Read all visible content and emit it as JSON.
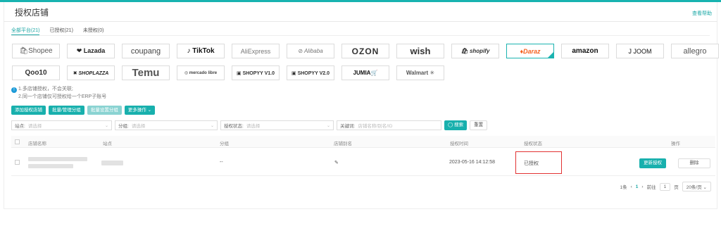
{
  "header": {
    "title": "授权店铺",
    "help": "查看帮助"
  },
  "tabs": [
    {
      "label": "全部平台(21)",
      "active": true
    },
    {
      "label": "已授权(21)",
      "active": false
    },
    {
      "label": "未授权(0)",
      "active": false
    }
  ],
  "platforms_row1": [
    {
      "label": "🛍Shopee",
      "name": "shopee"
    },
    {
      "label": "❤ Lazada",
      "name": "lazada"
    },
    {
      "label": "coupang",
      "name": "coupang"
    },
    {
      "label": "♪ TikTok",
      "name": "tiktok"
    },
    {
      "label": "AliExpress",
      "name": "aliexpress"
    },
    {
      "label": "⊘ Alibaba",
      "name": "alibaba"
    },
    {
      "label": "OZON",
      "name": "ozon"
    },
    {
      "label": "wish",
      "name": "wish"
    },
    {
      "label": "🛍 shopify",
      "name": "shopify"
    },
    {
      "label": "♦Daraz",
      "name": "daraz",
      "selected": true
    },
    {
      "label": "amazon",
      "name": "amazon"
    },
    {
      "label": "J JOOM",
      "name": "joom"
    },
    {
      "label": "allegro",
      "name": "allegro"
    }
  ],
  "platforms_row2": [
    {
      "label": "Qoo10",
      "name": "qoo10"
    },
    {
      "label": "✖ SHOPLAZZA",
      "name": "shoplazza"
    },
    {
      "label": "Temu",
      "name": "temu"
    },
    {
      "label": "◎ mercado libre",
      "name": "mercado"
    },
    {
      "label": "▣ SHOPYY V1.0",
      "name": "shopyy-v1"
    },
    {
      "label": "▣ SHOPYY V2.0",
      "name": "shopyy-v2"
    },
    {
      "label": "JUMIA🛒",
      "name": "jumia"
    },
    {
      "label": "Walmart ✳",
      "name": "walmart"
    }
  ],
  "notes": {
    "line1": "1.多店铺授权，不会关联;",
    "line2": "2.同一个店铺仅可授权给一个ERP子账号"
  },
  "actions": {
    "add_store": "添加授权店铺",
    "group_manage": "批量/管理分组",
    "batch_group": "批量设置分组",
    "more": "更多操作 ⌄"
  },
  "filters": {
    "site_label": "站点:",
    "site_placeholder": "请选择",
    "group_label": "分组:",
    "group_placeholder": "请选择",
    "status_label": "授权状态:",
    "status_placeholder": "请选择",
    "keyword_label": "关键词:",
    "keyword_placeholder": "店铺名称/别名/ID",
    "search": "◯ 搜索",
    "reset": "重置"
  },
  "table": {
    "columns": [
      "店铺名称",
      "站点",
      "分组",
      "店铺别名",
      "授权时间",
      "授权状态",
      "操作"
    ],
    "rows": [
      {
        "group": "--",
        "alias_icon": "✎",
        "auth_time": "2023-05-16 14:12:58",
        "status": "已授权",
        "update_btn": "更新授权",
        "delete_btn": "删除"
      }
    ]
  },
  "pagination": {
    "total": "1条",
    "prev": "‹",
    "current": "1",
    "next": "›",
    "goto_label": "前往",
    "goto_value": "1",
    "page_unit": "页",
    "page_size": "20条/页 ⌄"
  }
}
